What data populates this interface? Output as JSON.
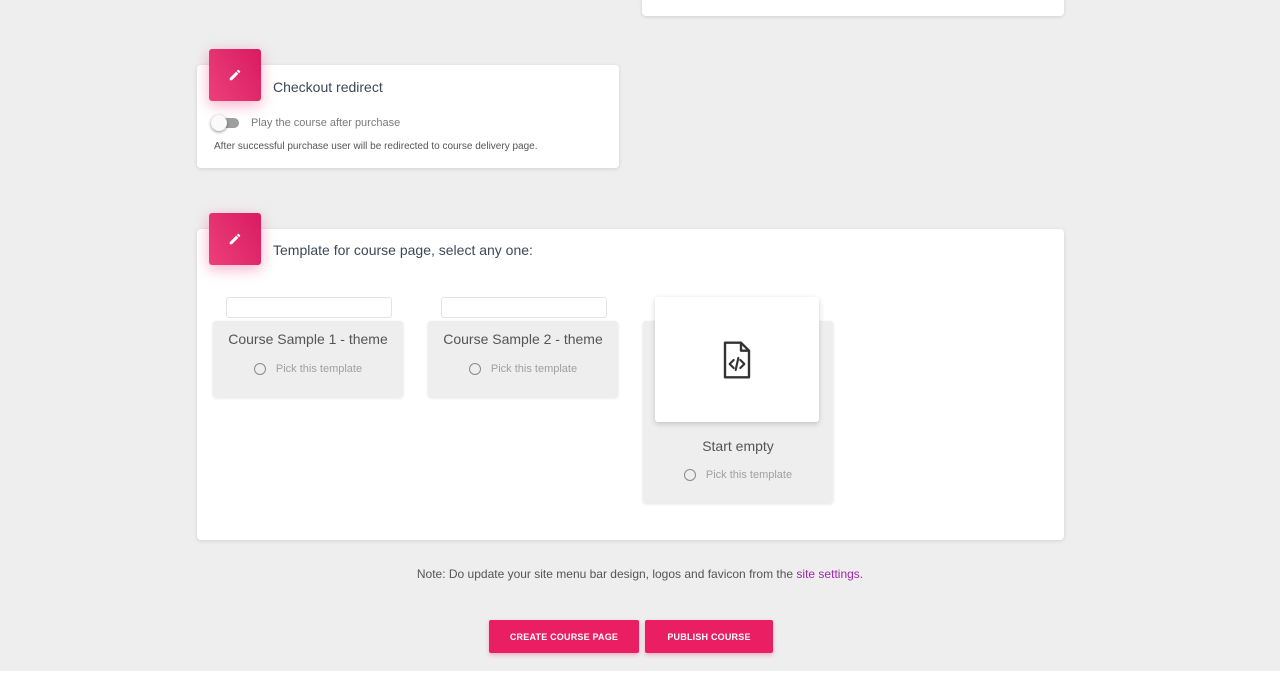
{
  "checkout": {
    "title": "Checkout redirect",
    "toggle_label": "Play the course after purchase",
    "toggle_on": false,
    "helper": "After successful purchase user will be redirected to course delivery page."
  },
  "template": {
    "title": "Template for course page, select any one:",
    "options": [
      {
        "name": "Course Sample 1 - theme",
        "pick_label": "Pick this template",
        "selected": false
      },
      {
        "name": "Course Sample 2 - theme",
        "pick_label": "Pick this template",
        "selected": false
      },
      {
        "name": "Start empty",
        "pick_label": "Pick this template",
        "selected": false,
        "icon": "code-file-icon"
      }
    ]
  },
  "note": {
    "prefix": "Note: Do update your site menu bar design, logos and favicon from the ",
    "link": "site settings",
    "suffix": "."
  },
  "actions": {
    "create_label": "CREATE COURSE PAGE",
    "publish_label": "PUBLISH COURSE"
  },
  "colors": {
    "accent": "#e91e63",
    "link": "#9c27b0",
    "background": "#eeeeee"
  }
}
